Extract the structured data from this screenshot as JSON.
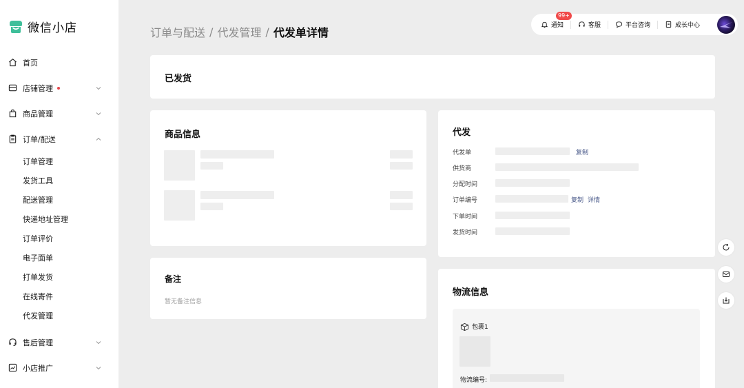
{
  "app": {
    "name": "微信小店",
    "brand_color": "#3fbf9a"
  },
  "sidebar": {
    "items": [
      {
        "label": "首页",
        "icon": "home-icon"
      },
      {
        "label": "店铺管理",
        "icon": "store-icon",
        "has_dot": true,
        "chevron": "down"
      },
      {
        "label": "商品管理",
        "icon": "bag-icon",
        "chevron": "down"
      },
      {
        "label": "订单/配送",
        "icon": "clipboard-icon",
        "chevron": "up"
      }
    ],
    "sub_items": [
      "订单管理",
      "发货工具",
      "配送管理",
      "快递地址管理",
      "订单评价",
      "电子面单",
      "打单发货",
      "在线寄件",
      "代发管理"
    ],
    "bottom_items": [
      {
        "label": "售后管理",
        "icon": "headset-icon",
        "chevron": "down"
      },
      {
        "label": "小店推广",
        "icon": "chart-icon",
        "chevron": "down"
      }
    ]
  },
  "breadcrumb": {
    "part1": "订单与配送",
    "part2": "代发管理",
    "current": "代发单详情",
    "sep": "/"
  },
  "topbar": {
    "notify_label": "通知",
    "notify_badge": "99+",
    "service_label": "客服",
    "consult_label": "平台咨询",
    "growth_label": "成长中心"
  },
  "status_card": {
    "text": "已发货"
  },
  "goods_card": {
    "title": "商品信息"
  },
  "remark_card": {
    "title": "备注",
    "empty_text": "暂无备注信息"
  },
  "dropship_card": {
    "title": "代发",
    "rows": [
      "代发单",
      "供货商",
      "分配时间",
      "订单编号",
      "下单时间",
      "发货时间"
    ],
    "copy_label": "复制",
    "copy_label_2": "复制",
    "detail_label": "详情"
  },
  "logistics_card": {
    "title": "物流信息",
    "package_label": "包裹1",
    "tracking_label": "物流编号:"
  }
}
